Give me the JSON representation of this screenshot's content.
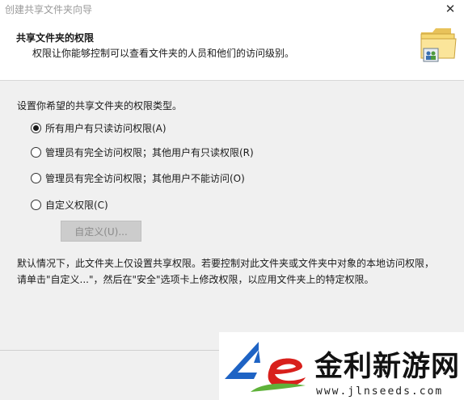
{
  "window": {
    "title": "创建共享文件夹向导",
    "close_glyph": "✕"
  },
  "header": {
    "title": "共享文件夹的权限",
    "subtitle": "权限让你能够控制可以查看文件夹的人员和他们的访问级别。",
    "icon": "shared-folder-icon"
  },
  "content": {
    "prompt": "设置你希望的共享文件夹的权限类型。",
    "options": [
      {
        "label": "所有用户有只读访问权限(A)",
        "checked": true
      },
      {
        "label": "管理员有完全访问权限；其他用户有只读权限(R)",
        "checked": false
      },
      {
        "label": "管理员有完全访问权限；其他用户不能访问(O)",
        "checked": false
      },
      {
        "label": "自定义权限(C)",
        "checked": false
      }
    ],
    "custom_button": "自定义(U)...",
    "note": "默认情况下，此文件夹上仅设置共享权限。若要控制对此文件夹或文件夹中对象的本地访问权限，请单击\"自定义...\"，然后在\"安全\"选项卡上修改权限，以应用文件夹上的特定权限。"
  },
  "watermark": {
    "name": "金利新游网",
    "url": "www.jlnseeds.com",
    "colors": {
      "blue": "#1e63c4",
      "red": "#d8201c",
      "green": "#5fb23a"
    }
  }
}
